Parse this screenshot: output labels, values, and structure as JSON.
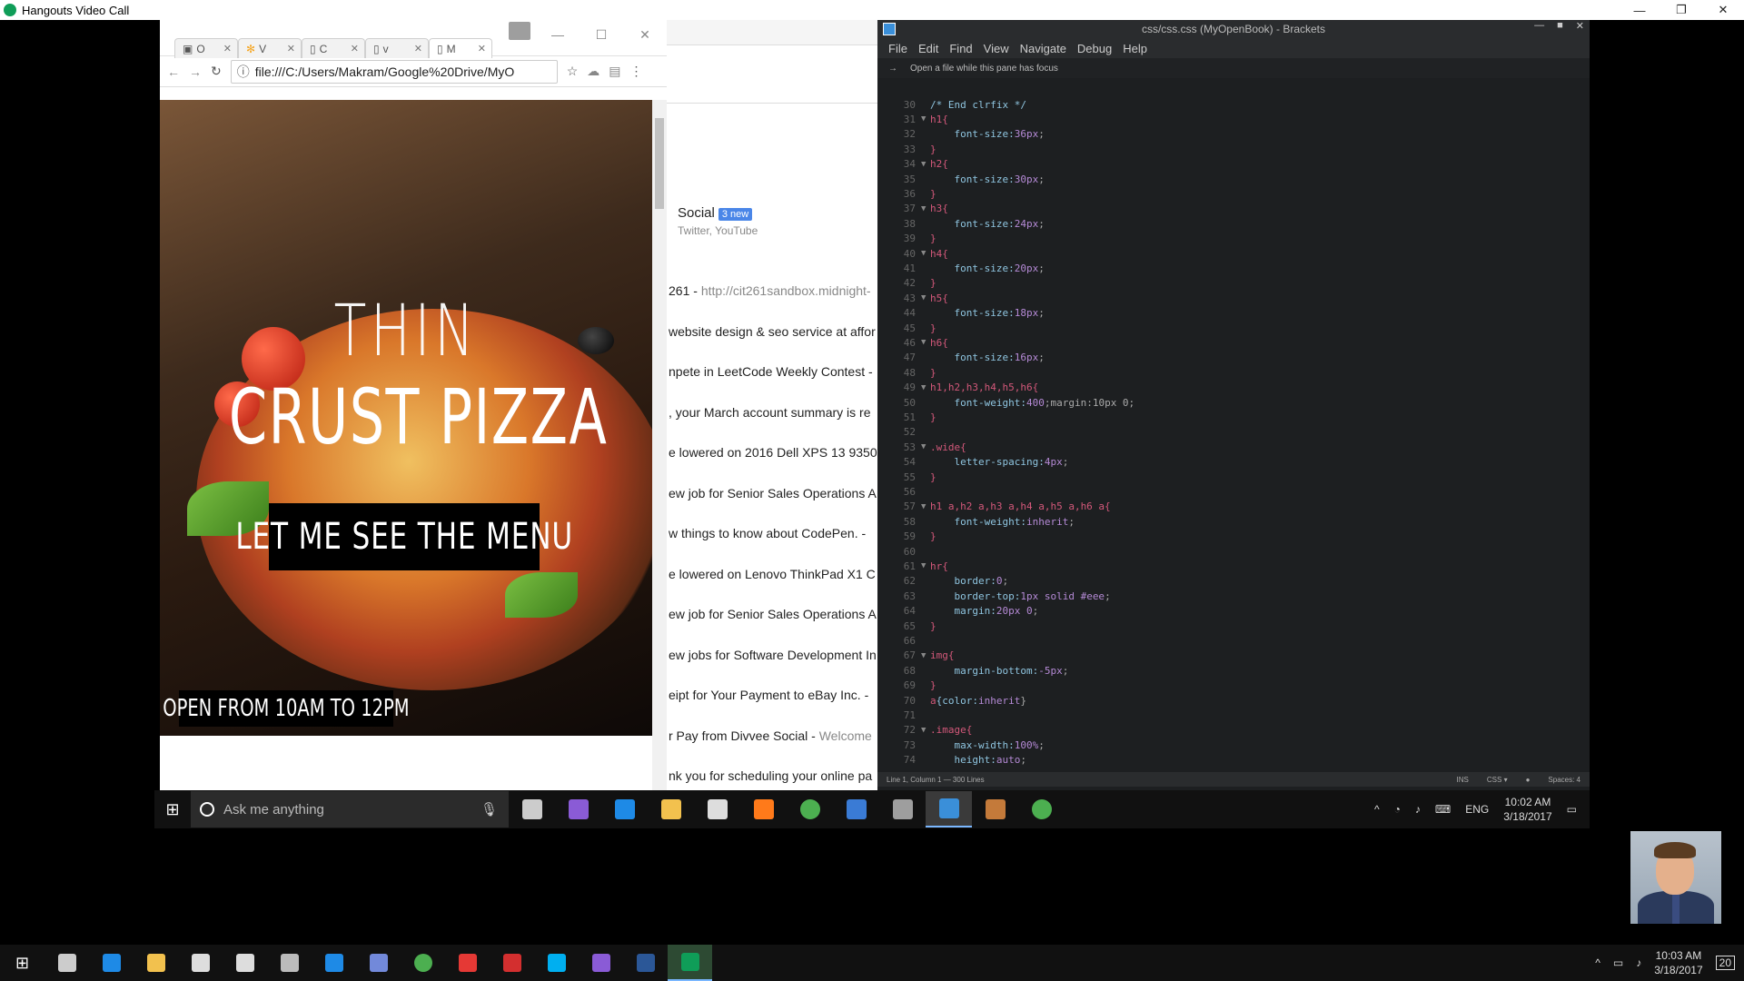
{
  "window": {
    "title": "Hangouts Video Call",
    "controls": [
      "—",
      "❐",
      "✕"
    ]
  },
  "chrome": {
    "tabs": [
      {
        "short": "O",
        "icon": "tab-favicon"
      },
      {
        "short": "V",
        "icon": "tab-favicon"
      },
      {
        "short": "C",
        "icon": "tab-favicon"
      },
      {
        "short": "v",
        "icon": "tab-favicon"
      },
      {
        "short": "M",
        "icon": "tab-favicon"
      }
    ],
    "address": "file:///C:/Users/Makram/Google%20Drive/MyO",
    "page": {
      "heading_line1": "THIN",
      "heading_line2": "CRUST PIZZA",
      "button_label": "LET ME SEE THE MENU",
      "hours": "OPEN FROM 10AM TO 12PM"
    }
  },
  "gmail": {
    "social_label": "Social",
    "social_badge": "3 new",
    "social_sub": "Twitter, YouTube",
    "rows": [
      {
        "text": "261 - ",
        "snip": "http://cit261sandbox.midnight-"
      },
      {
        "text": "website design & seo service at affor",
        "snip": ""
      },
      {
        "text": "npete in LeetCode Weekly Contest -",
        "snip": ""
      },
      {
        "text": ", your March account summary is re",
        "snip": ""
      },
      {
        "text": "e lowered on 2016 Dell XPS 13 9350",
        "snip": ""
      },
      {
        "text": "ew job for Senior Sales Operations A",
        "snip": ""
      },
      {
        "text": "w things to know about CodePen. -",
        "snip": ""
      },
      {
        "text": "e lowered on Lenovo ThinkPad X1 C",
        "snip": ""
      },
      {
        "text": "ew job for Senior Sales Operations A",
        "snip": ""
      },
      {
        "text": "ew jobs for Software Development In",
        "snip": ""
      },
      {
        "text": "eipt for Your Payment to eBay Inc. -",
        "snip": ""
      },
      {
        "text": "r Pay from Divvee Social - ",
        "snip": "Welcome"
      },
      {
        "text": "nk you for scheduling your online pa",
        "snip": ""
      }
    ]
  },
  "brackets": {
    "title": "css/css.css (MyOpenBook) - Brackets",
    "menu": [
      "File",
      "Edit",
      "Find",
      "View",
      "Navigate",
      "Debug",
      "Help"
    ],
    "hint": "Open a file while this pane has focus",
    "lines": [
      {
        "n": "30",
        "fold": "",
        "sel": "",
        "prop": "/* End clrfix */",
        "val": "",
        "end": ""
      },
      {
        "n": "31",
        "fold": "▼",
        "sel": "h1{",
        "prop": "",
        "val": "",
        "end": ""
      },
      {
        "n": "32",
        "fold": "",
        "sel": "",
        "prop": "    font-size:",
        "val": "36px",
        "end": ";"
      },
      {
        "n": "33",
        "fold": "",
        "sel": "}",
        "prop": "",
        "val": "",
        "end": ""
      },
      {
        "n": "34",
        "fold": "▼",
        "sel": "h2{",
        "prop": "",
        "val": "",
        "end": ""
      },
      {
        "n": "35",
        "fold": "",
        "sel": "",
        "prop": "    font-size:",
        "val": "30px",
        "end": ";"
      },
      {
        "n": "36",
        "fold": "",
        "sel": "}",
        "prop": "",
        "val": "",
        "end": ""
      },
      {
        "n": "37",
        "fold": "▼",
        "sel": "h3{",
        "prop": "",
        "val": "",
        "end": ""
      },
      {
        "n": "38",
        "fold": "",
        "sel": "",
        "prop": "    font-size:",
        "val": "24px",
        "end": ";"
      },
      {
        "n": "39",
        "fold": "",
        "sel": "}",
        "prop": "",
        "val": "",
        "end": ""
      },
      {
        "n": "40",
        "fold": "▼",
        "sel": "h4{",
        "prop": "",
        "val": "",
        "end": ""
      },
      {
        "n": "41",
        "fold": "",
        "sel": "",
        "prop": "    font-size:",
        "val": "20px",
        "end": ";"
      },
      {
        "n": "42",
        "fold": "",
        "sel": "}",
        "prop": "",
        "val": "",
        "end": ""
      },
      {
        "n": "43",
        "fold": "▼",
        "sel": "h5{",
        "prop": "",
        "val": "",
        "end": ""
      },
      {
        "n": "44",
        "fold": "",
        "sel": "",
        "prop": "    font-size:",
        "val": "18px",
        "end": ";"
      },
      {
        "n": "45",
        "fold": "",
        "sel": "}",
        "prop": "",
        "val": "",
        "end": ""
      },
      {
        "n": "46",
        "fold": "▼",
        "sel": "h6{",
        "prop": "",
        "val": "",
        "end": ""
      },
      {
        "n": "47",
        "fold": "",
        "sel": "",
        "prop": "    font-size:",
        "val": "16px",
        "end": ";"
      },
      {
        "n": "48",
        "fold": "",
        "sel": "}",
        "prop": "",
        "val": "",
        "end": ""
      },
      {
        "n": "49",
        "fold": "▼",
        "sel": "h1,h2,h3,h4,h5,h6{",
        "prop": "",
        "val": "",
        "end": ""
      },
      {
        "n": "50",
        "fold": "",
        "sel": "",
        "prop": "    font-weight:",
        "val": "400",
        "end": ";margin:10px 0;"
      },
      {
        "n": "51",
        "fold": "",
        "sel": "}",
        "prop": "",
        "val": "",
        "end": ""
      },
      {
        "n": "52",
        "fold": "",
        "sel": "",
        "prop": "",
        "val": "",
        "end": ""
      },
      {
        "n": "53",
        "fold": "▼",
        "sel": ".wide{",
        "prop": "",
        "val": "",
        "end": ""
      },
      {
        "n": "54",
        "fold": "",
        "sel": "",
        "prop": "    letter-spacing:",
        "val": "4px",
        "end": ";"
      },
      {
        "n": "55",
        "fold": "",
        "sel": "}",
        "prop": "",
        "val": "",
        "end": ""
      },
      {
        "n": "56",
        "fold": "",
        "sel": "",
        "prop": "",
        "val": "",
        "end": ""
      },
      {
        "n": "57",
        "fold": "▼",
        "sel": "h1 a,h2 a,h3 a,h4 a,h5 a,h6 a{",
        "prop": "",
        "val": "",
        "end": ""
      },
      {
        "n": "58",
        "fold": "",
        "sel": "",
        "prop": "    font-weight:",
        "val": "inherit",
        "end": ";"
      },
      {
        "n": "59",
        "fold": "",
        "sel": "}",
        "prop": "",
        "val": "",
        "end": ""
      },
      {
        "n": "60",
        "fold": "",
        "sel": "",
        "prop": "",
        "val": "",
        "end": ""
      },
      {
        "n": "61",
        "fold": "▼",
        "sel": "hr{",
        "prop": "",
        "val": "",
        "end": ""
      },
      {
        "n": "62",
        "fold": "",
        "sel": "",
        "prop": "    border:",
        "val": "0",
        "end": ";"
      },
      {
        "n": "63",
        "fold": "",
        "sel": "",
        "prop": "    border-top:",
        "val": "1px solid #eee",
        "end": ";"
      },
      {
        "n": "64",
        "fold": "",
        "sel": "",
        "prop": "    margin:",
        "val": "20px 0",
        "end": ";"
      },
      {
        "n": "65",
        "fold": "",
        "sel": "}",
        "prop": "",
        "val": "",
        "end": ""
      },
      {
        "n": "66",
        "fold": "",
        "sel": "",
        "prop": "",
        "val": "",
        "end": ""
      },
      {
        "n": "67",
        "fold": "▼",
        "sel": "img{",
        "prop": "",
        "val": "",
        "end": ""
      },
      {
        "n": "68",
        "fold": "",
        "sel": "",
        "prop": "    margin-bottom:",
        "val": "-5px",
        "end": ";"
      },
      {
        "n": "69",
        "fold": "",
        "sel": "}",
        "prop": "",
        "val": "",
        "end": ""
      },
      {
        "n": "70",
        "fold": "",
        "sel": "a",
        "prop": "{color:",
        "val": "inherit",
        "end": "}"
      },
      {
        "n": "71",
        "fold": "",
        "sel": "",
        "prop": "",
        "val": "",
        "end": ""
      },
      {
        "n": "72",
        "fold": "▼",
        "sel": ".image{",
        "prop": "",
        "val": "",
        "end": ""
      },
      {
        "n": "73",
        "fold": "",
        "sel": "",
        "prop": "    max-width:",
        "val": "100%",
        "end": ";"
      },
      {
        "n": "74",
        "fold": "",
        "sel": "",
        "prop": "    height:",
        "val": "auto",
        "end": ";"
      }
    ],
    "status_left": "Line 1, Column 1 — 300 Lines",
    "status_ins": "INS",
    "status_lang": "CSS ▾",
    "status_spaces": "Spaces: 4"
  },
  "remote_taskbar": {
    "search_placeholder": "Ask me anything",
    "time": "10:02 AM",
    "date": "3/18/2017",
    "lang": "ENG",
    "icons": [
      "task-view-icon",
      "visual-studio-icon",
      "edge-icon",
      "file-explorer-icon",
      "window-icon",
      "firefox-icon",
      "chrome-icon",
      "store-icon",
      "photos-icon",
      "brackets-icon",
      "app-icon",
      "chrome-icon"
    ]
  },
  "local_taskbar": {
    "time": "10:03 AM",
    "date": "3/18/2017",
    "notifications": "20",
    "icons": [
      "task-view-icon",
      "edge-icon",
      "file-explorer-icon",
      "store-icon",
      "alarm-icon",
      "calculator-icon",
      "ie-icon",
      "discord-icon",
      "chrome-icon",
      "app-icon",
      "acrobat-icon",
      "skype-icon",
      "visual-studio-icon",
      "word-icon",
      "hangouts-icon"
    ]
  },
  "colors": {
    "accent": "#3a8fd9",
    "gmail_badge": "#4a86e8",
    "hangouts": "#0f9d58"
  }
}
